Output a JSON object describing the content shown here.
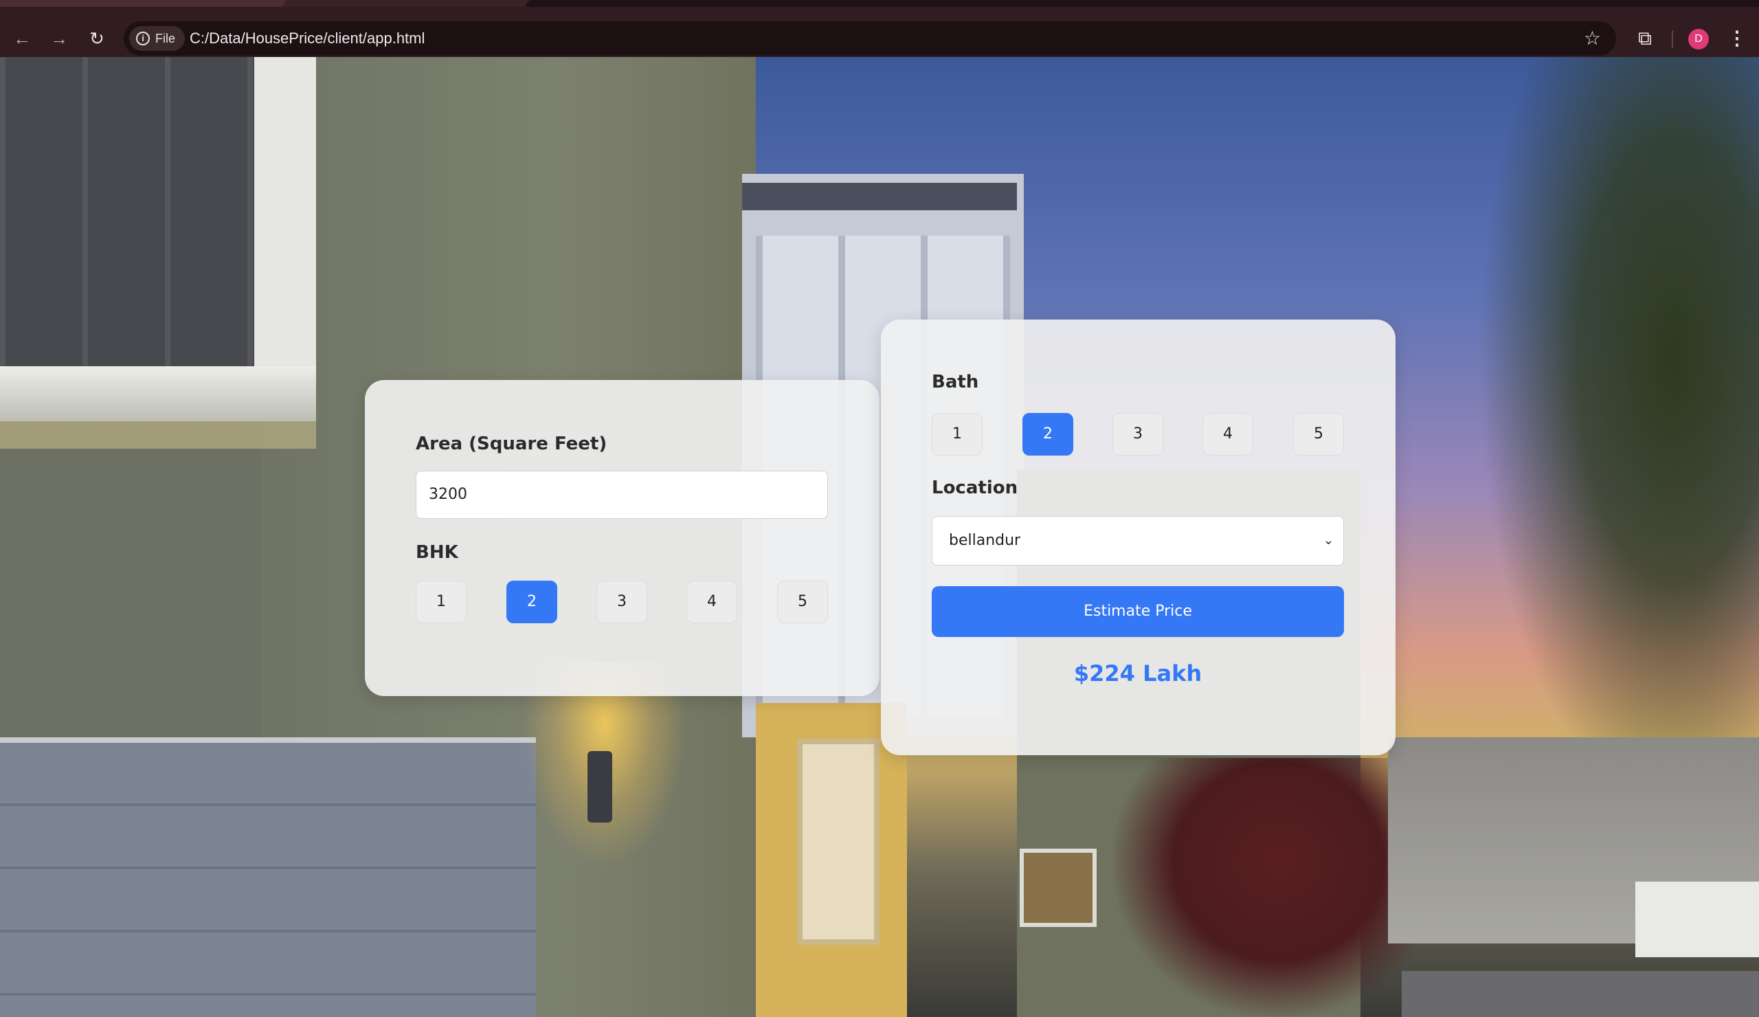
{
  "browser": {
    "site_chip_label": "File",
    "url": "C:/Data/HousePrice/client/app.html",
    "profile_initial": "D",
    "icons": {
      "back": "arrow-left",
      "forward": "arrow-right",
      "reload": "reload",
      "info": "info",
      "bookmark": "star",
      "extensions": "puzzle",
      "menu": "more-vertical"
    }
  },
  "form": {
    "area": {
      "label": "Area (Square Feet)",
      "value": "3200"
    },
    "bhk": {
      "label": "BHK",
      "options": [
        "1",
        "2",
        "3",
        "4",
        "5"
      ],
      "selected": "2"
    },
    "bath": {
      "label": "Bath",
      "options": [
        "1",
        "2",
        "3",
        "4",
        "5"
      ],
      "selected": "2"
    },
    "location": {
      "label": "Location",
      "selected": "bellandur"
    },
    "estimate_button": "Estimate Price",
    "result": "$224 Lakh"
  },
  "colors": {
    "accent": "#3478f6",
    "card_bg": "#f0f0f0",
    "chrome_bg": "#301c21"
  }
}
